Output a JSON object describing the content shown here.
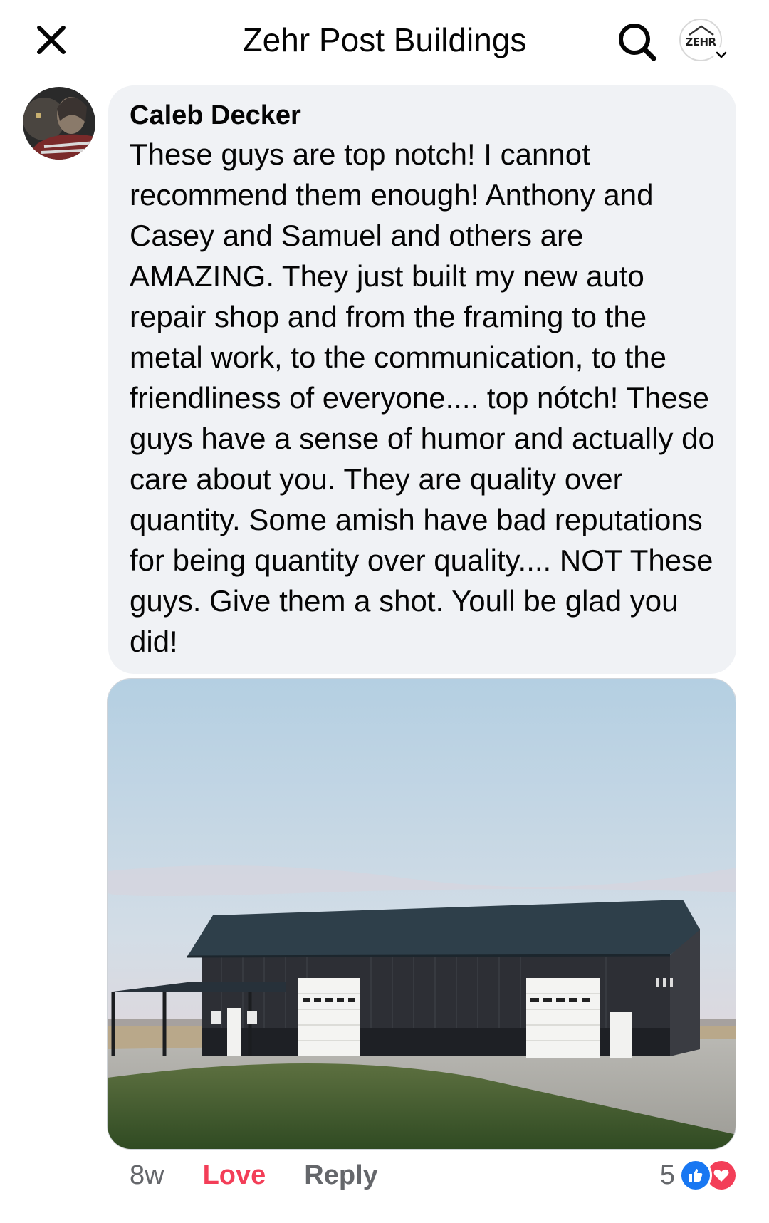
{
  "header": {
    "title": "Zehr Post Buildings",
    "close_icon": "close-icon",
    "search_icon": "search-icon",
    "profile_logo_text": "ZEHR"
  },
  "comment": {
    "author": "Caleb Decker",
    "text": "These guys are top notch! I cannot recommend them enough! Anthony and Casey and Samuel and others are AMAZING. They just built my new auto repair shop and from the framing to the metal work, to the communication, to the friendliness of everyone.... top nótch! These guys have a sense of humor and actually do care about you. They are quality over quantity. Some amish have bad reputations for being quantity over quality.... NOT These guys. Give them a shot. Youll be glad you did!",
    "attachment": "photo of a dark gray post-frame building with white overhead doors"
  },
  "actions": {
    "timestamp": "8w",
    "love_label": "Love",
    "reply_label": "Reply",
    "reaction_count": "5",
    "reactions": [
      "like-icon",
      "love-icon"
    ]
  },
  "colors": {
    "love": "#f33e58",
    "like": "#1877f2",
    "muted": "#65676b",
    "bubble": "#f0f2f5"
  }
}
